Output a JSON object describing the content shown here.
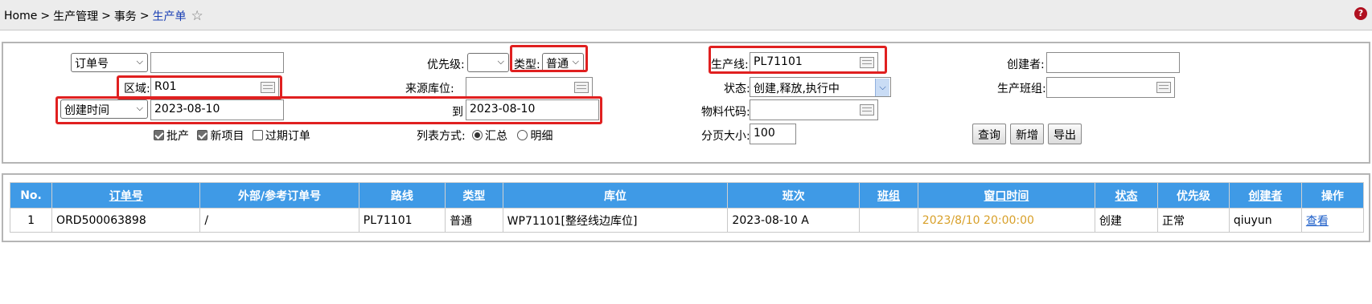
{
  "breadcrumb": {
    "items": [
      "Home",
      "生产管理",
      "事务"
    ],
    "current": "生产单",
    "separator": ">"
  },
  "icons": {
    "star": "star-outline-icon",
    "help": "help-circle-icon",
    "calendar": "calendar-icon"
  },
  "colors": {
    "header_blue": "#3f9ae6",
    "highlight_red": "#e02020",
    "window_time": "#d8a02a",
    "link_blue": "#1a5cc8"
  },
  "filters": {
    "order_field_select": "订单号",
    "order_value": "",
    "priority_label": "优先级:",
    "priority_value": "",
    "type_label": "类型:",
    "type_value": "普通",
    "line_label": "生产线:",
    "line_value": "PL71101",
    "creator_label": "创建者:",
    "creator_value": "",
    "area_label": "区域:",
    "area_value": "R01",
    "source_loc_label": "来源库位:",
    "source_loc_value": "",
    "status_label": "状态:",
    "status_value": "创建,释放,执行中",
    "shift_group_label": "生产班组:",
    "shift_group_value": "",
    "date_field_select": "创建时间",
    "date_from": "2023-08-10",
    "to_label": "到",
    "date_to": "2023-08-10",
    "material_label": "物料代码:",
    "material_value": "",
    "chk_batch_label": "批产",
    "chk_batch_checked": true,
    "chk_newitem_label": "新项目",
    "chk_newitem_checked": true,
    "chk_overdue_label": "过期订单",
    "chk_overdue_checked": false,
    "list_mode_label": "列表方式:",
    "list_mode_summary": "汇总",
    "list_mode_detail": "明细",
    "list_mode_selected": "汇总",
    "page_size_label": "分页大小:",
    "page_size_value": "100"
  },
  "buttons": {
    "search": "查询",
    "add": "新增",
    "export": "导出"
  },
  "table": {
    "columns": [
      "No.",
      "订单号",
      "外部/参考订单号",
      "路线",
      "类型",
      "库位",
      "班次",
      "班组",
      "窗口时间",
      "状态",
      "优先级",
      "创建者",
      "操作"
    ],
    "rows": [
      {
        "no": "1",
        "order_no": "ORD500063898",
        "ext_ref": "/",
        "route": "PL71101",
        "type": "普通",
        "location": "WP71101[整经线边库位]",
        "shift": "2023-08-10 A",
        "group": "",
        "window_time": "2023/8/10 20:00:00",
        "status": "创建",
        "priority": "正常",
        "creator": "qiuyun",
        "action": "查看"
      }
    ]
  }
}
